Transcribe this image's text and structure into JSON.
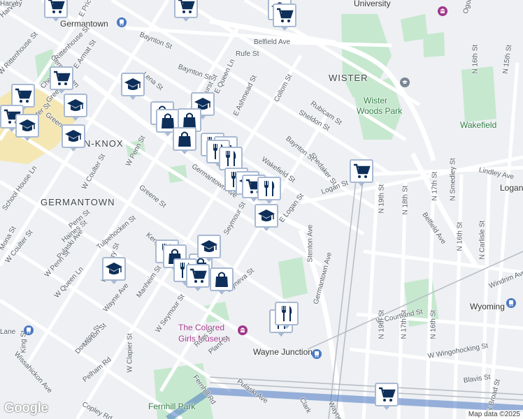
{
  "map": {
    "attribution": "Map data ©2025",
    "logo_text": "Google",
    "colors": {
      "background": "#eef0f3",
      "road": "#ffffff",
      "park": "#c6e8cf",
      "highlight": "#f5e7b3",
      "pin_border": "#a8b9d3",
      "pin_icon": "#0d2f5a",
      "transit": "#6a93c8",
      "poi": "#a1378b"
    },
    "labels": [
      {
        "text": "Harvey St",
        "kind": "street"
      },
      {
        "text": "Germantown",
        "kind": "place"
      },
      {
        "text": "E Price St",
        "kind": "street"
      },
      {
        "text": "Baynton St",
        "kind": "street"
      },
      {
        "text": "University",
        "kind": "place"
      },
      {
        "text": "Belfield Ave",
        "kind": "street"
      },
      {
        "text": "Rufe St",
        "kind": "street"
      },
      {
        "text": "Baynton St",
        "kind": "street"
      },
      {
        "text": "W Rittenhouse St",
        "kind": "street"
      },
      {
        "text": "Germantown",
        "kind": "street"
      },
      {
        "text": "E Armat St",
        "kind": "street"
      },
      {
        "text": "Lena St",
        "kind": "street"
      },
      {
        "text": "E Queen Ln",
        "kind": "street"
      },
      {
        "text": "E Ashmead St",
        "kind": "street"
      },
      {
        "text": "Collom St",
        "kind": "street"
      },
      {
        "text": "WISTER",
        "kind": "big"
      },
      {
        "text": "Rubicam St",
        "kind": "street"
      },
      {
        "text": "Wister",
        "kind": "park"
      },
      {
        "text": "Woods Park",
        "kind": "park"
      },
      {
        "text": "Sheldon St",
        "kind": "street"
      },
      {
        "text": "Wakefield",
        "kind": "park"
      },
      {
        "text": "Greene St",
        "kind": "street"
      },
      {
        "text": "N-KNOX",
        "kind": "big"
      },
      {
        "text": "Baynton St",
        "kind": "street"
      },
      {
        "text": "Shedaker St",
        "kind": "street"
      },
      {
        "text": "W Penn St",
        "kind": "street"
      },
      {
        "text": "Wakefield St",
        "kind": "street"
      },
      {
        "text": "Lindley Ave",
        "kind": "street"
      },
      {
        "text": "W Coulter St",
        "kind": "street"
      },
      {
        "text": "Logan",
        "kind": "place"
      },
      {
        "text": "Germantown Ave",
        "kind": "street"
      },
      {
        "text": "Greene St",
        "kind": "street"
      },
      {
        "text": "GERMANTOWN",
        "kind": "big"
      },
      {
        "text": "School House Ln",
        "kind": "street"
      },
      {
        "text": "E Logan St",
        "kind": "street"
      },
      {
        "text": "Seymour St",
        "kind": "street"
      },
      {
        "text": "N 19th St",
        "kind": "street"
      },
      {
        "text": "N 18th St",
        "kind": "street"
      },
      {
        "text": "N 17th St",
        "kind": "street"
      },
      {
        "text": "N Smedley St",
        "kind": "street"
      },
      {
        "text": "Belfield Ave",
        "kind": "street"
      },
      {
        "text": "N 16th St",
        "kind": "street"
      },
      {
        "text": "N Carlisle St",
        "kind": "street"
      },
      {
        "text": "W Coulter St",
        "kind": "street"
      },
      {
        "text": "Pulaski Ave",
        "kind": "street"
      },
      {
        "text": "W Penn St",
        "kind": "street"
      },
      {
        "text": "W Queen Ln",
        "kind": "street"
      },
      {
        "text": "Stenton Ave",
        "kind": "street"
      },
      {
        "text": "Kenyon St",
        "kind": "street"
      },
      {
        "text": "Manheim St",
        "kind": "street"
      },
      {
        "text": "W Seymour St",
        "kind": "street"
      },
      {
        "text": "Wyneva St",
        "kind": "street"
      },
      {
        "text": "Windrim Ave",
        "kind": "street"
      },
      {
        "text": "Wyoming",
        "kind": "place"
      },
      {
        "text": "King St",
        "kind": "street"
      },
      {
        "text": "W Courtland St",
        "kind": "street"
      },
      {
        "text": "The Colored",
        "kind": "poi"
      },
      {
        "text": "Girls Museum",
        "kind": "poi"
      },
      {
        "text": "Germantown Ave",
        "kind": "street"
      },
      {
        "text": "Wayne Junction",
        "kind": "transit"
      },
      {
        "text": "W Wingohocking St",
        "kind": "street"
      },
      {
        "text": "Wissahickon Ave",
        "kind": "street"
      },
      {
        "text": "W Clapier St",
        "kind": "street"
      },
      {
        "text": "Pulaski Ave",
        "kind": "street"
      },
      {
        "text": "Fernhill Rd",
        "kind": "street"
      },
      {
        "text": "Blavis St",
        "kind": "street"
      },
      {
        "text": "Copley Rd",
        "kind": "street"
      },
      {
        "text": "Fernhill Park",
        "kind": "park"
      },
      {
        "text": "Clark",
        "kind": "street"
      },
      {
        "text": "Wayne",
        "kind": "street"
      },
      {
        "text": "N 19th St",
        "kind": "street"
      },
      {
        "text": "N 17th St",
        "kind": "street"
      },
      {
        "text": "N 16th St",
        "kind": "street"
      },
      {
        "text": "N Broad St",
        "kind": "street"
      },
      {
        "text": "N 15th St",
        "kind": "street"
      },
      {
        "text": "N 16th St",
        "kind": "street"
      },
      {
        "text": "Ogontz Ave",
        "kind": "street"
      },
      {
        "text": "Lane",
        "kind": "street"
      },
      {
        "text": "Harvey",
        "kind": "street"
      },
      {
        "text": "Hansberry St",
        "kind": "street"
      },
      {
        "text": "Greene St",
        "kind": "street"
      },
      {
        "text": "Wister St",
        "kind": "street"
      },
      {
        "text": "Chelten",
        "kind": "street"
      },
      {
        "text": "Bringhurst St",
        "kind": "street"
      },
      {
        "text": "Rittenhouse St",
        "kind": "street"
      },
      {
        "text": "Wayne Ave",
        "kind": "street"
      },
      {
        "text": "Dounton St",
        "kind": "street"
      },
      {
        "text": "Ross St",
        "kind": "street"
      },
      {
        "text": "Morton St",
        "kind": "street"
      },
      {
        "text": "Logan St",
        "kind": "street"
      },
      {
        "text": "Tulpehocken St",
        "kind": "street"
      },
      {
        "text": "Plant St",
        "kind": "street"
      },
      {
        "text": "Mona St",
        "kind": "street"
      },
      {
        "text": "Pelham Rd",
        "kind": "street"
      },
      {
        "text": "Haines St",
        "kind": "street"
      },
      {
        "text": "Penn St",
        "kind": "street"
      }
    ],
    "markers": [
      {
        "type": "grocery",
        "icon": "shopping-cart-icon"
      },
      {
        "type": "grocery",
        "icon": "shopping-cart-icon"
      },
      {
        "type": "school",
        "icon": "graduation-cap-icon"
      },
      {
        "type": "grocery",
        "icon": "shopping-cart-icon"
      },
      {
        "type": "school",
        "icon": "graduation-cap-icon"
      },
      {
        "type": "grocery",
        "icon": "shopping-cart-icon"
      },
      {
        "type": "school",
        "icon": "graduation-cap-icon"
      },
      {
        "type": "grocery",
        "icon": "shopping-cart-icon"
      },
      {
        "type": "grocery",
        "icon": "shopping-cart-icon"
      },
      {
        "type": "school",
        "icon": "graduation-cap-icon"
      },
      {
        "type": "school",
        "icon": "graduation-cap-icon"
      },
      {
        "type": "shopping",
        "icon": "shopping-bag-icon"
      },
      {
        "type": "shopping",
        "icon": "shopping-bag-icon"
      },
      {
        "type": "school",
        "icon": "graduation-cap-icon"
      },
      {
        "type": "shopping",
        "icon": "shopping-bag-icon"
      },
      {
        "type": "restaurant",
        "icon": "fork-knife-icon"
      },
      {
        "type": "shopping",
        "icon": "shopping-bag-icon"
      },
      {
        "type": "shopping",
        "icon": "shopping-bag-icon"
      },
      {
        "type": "restaurant",
        "icon": "fork-knife-icon"
      },
      {
        "type": "restaurant",
        "icon": "fork-knife-icon"
      },
      {
        "type": "restaurant",
        "icon": "fork-knife-icon"
      },
      {
        "type": "school",
        "icon": "graduation-cap-icon"
      },
      {
        "type": "grocery",
        "icon": "shopping-cart-icon"
      },
      {
        "type": "restaurant",
        "icon": "fork-knife-icon"
      },
      {
        "type": "school",
        "icon": "graduation-cap-icon"
      },
      {
        "type": "restaurant",
        "icon": "fork-knife-icon"
      },
      {
        "type": "shopping",
        "icon": "shopping-bag-icon"
      },
      {
        "type": "shopping",
        "icon": "shopping-bag-icon"
      },
      {
        "type": "school",
        "icon": "graduation-cap-icon"
      },
      {
        "type": "restaurant",
        "icon": "fork-knife-icon"
      },
      {
        "type": "grocery",
        "icon": "shopping-cart-icon"
      }
    ]
  }
}
